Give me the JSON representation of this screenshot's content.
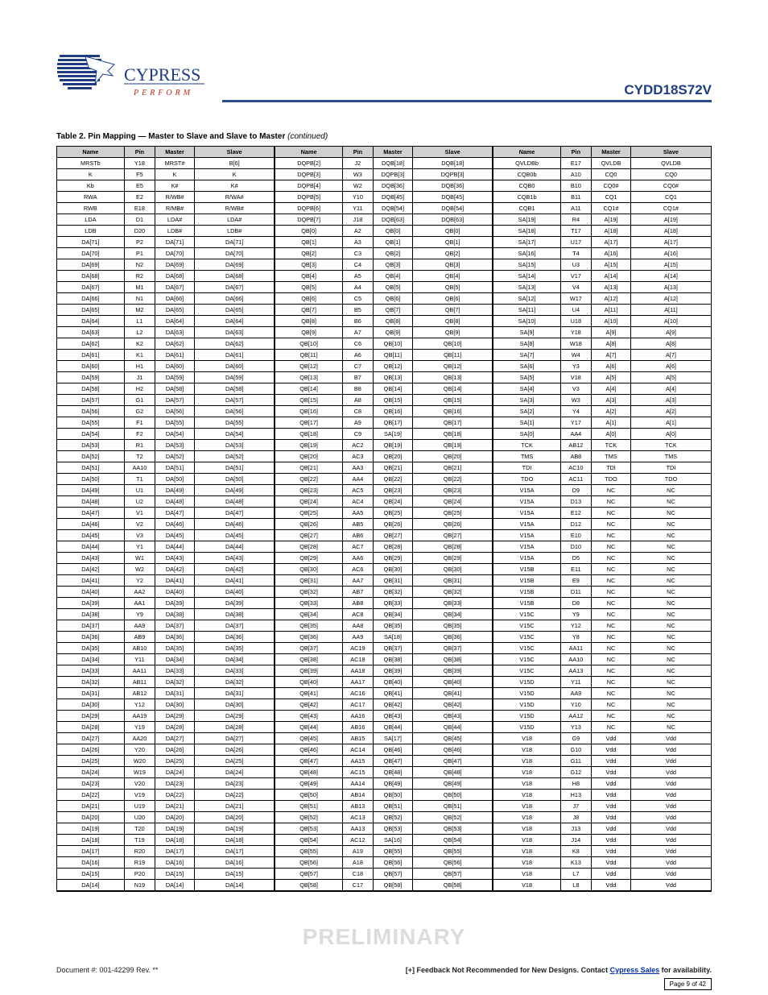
{
  "header": {
    "part": "CYDD18S72V"
  },
  "footer": {
    "watermark": "PRELIMINARY",
    "docnum": "Document #: 001-42299 Rev. **",
    "avail_pre": "[+] Feedback  Not Recommended for New Designs.\nContact ",
    "avail_link": "Cypress Sales",
    "avail_post": " for availability.",
    "page_label": "Page 9 of 42"
  },
  "table": {
    "caption_prefix": "Table 2. ",
    "caption_title": "Pin Mapping — Master to Slave and Slave to Master ",
    "caption_suffix": "(continued)",
    "headers": [
      "Name",
      "Pin",
      "Master",
      "Slave",
      "Name",
      "Pin",
      "Master",
      "Slave",
      "Name",
      "Pin",
      "Master",
      "Slave"
    ],
    "rows": [
      [
        "MRSTb",
        "Y18",
        "MRST#",
        "B[6]",
        "DQPB[2]",
        "J2",
        "DQB[18]",
        "DQB[18]",
        "QVLDBb",
        "E17",
        "QVLDB",
        "QVLDB"
      ],
      [
        "K",
        "F5",
        "K",
        "K",
        "DQPB[3]",
        "W3",
        "DQPB[3]",
        "DQPB[3]",
        "CQB0b",
        "A10",
        "CQ0",
        "CQ0"
      ],
      [
        "Kb",
        "E5",
        "K#",
        "K#",
        "DQPB[4]",
        "W2",
        "DQB[36]",
        "DQB[36]",
        "CQB0",
        "B10",
        "CQ0#",
        "CQ0#"
      ],
      [
        "RWA",
        "E2",
        "R/WB#",
        "R/WA#",
        "DQPB[5]",
        "Y10",
        "DQB[45]",
        "DQB[45]",
        "CQB1b",
        "B11",
        "CQ1",
        "CQ1"
      ],
      [
        "RWB",
        "E18",
        "R/MB#",
        "R/WB#",
        "DQPB[6]",
        "Y11",
        "DQB[54]",
        "DQB[54]",
        "CQB1",
        "A11",
        "CQ1#",
        "CQ1#"
      ],
      [
        "LDA",
        "D1",
        "LDA#",
        "LDA#",
        "DQPB[7]",
        "J18",
        "DQB[63]",
        "DQB[63]",
        "SA[19]",
        "R4",
        "A[19]",
        "A[19]"
      ],
      [
        "LDB",
        "D20",
        "LDB#",
        "LDB#",
        "QB[0]",
        "A2",
        "QB[0]",
        "QB[0]",
        "SA[18]",
        "T17",
        "A[18]",
        "A[18]"
      ],
      [
        "DA[71]",
        "P2",
        "DA[71]",
        "DA[71]",
        "QB[1]",
        "A3",
        "QB[1]",
        "QB[1]",
        "SA[17]",
        "U17",
        "A[17]",
        "A[17]"
      ],
      [
        "DA[70]",
        "P1",
        "DA[70]",
        "DA[70]",
        "QB[2]",
        "C3",
        "QB[2]",
        "QB[2]",
        "SA[16]",
        "T4",
        "A[16]",
        "A[16]"
      ],
      [
        "DA[69]",
        "N2",
        "DA[69]",
        "DA[69]",
        "QB[3]",
        "C4",
        "QB[3]",
        "QB[3]",
        "SA[15]",
        "U3",
        "A[15]",
        "A[15]"
      ],
      [
        "DA[68]",
        "R2",
        "DA[68]",
        "DA[68]",
        "QB[4]",
        "A5",
        "QB[4]",
        "QB[4]",
        "SA[14]",
        "V17",
        "A[14]",
        "A[14]"
      ],
      [
        "DA[67]",
        "M1",
        "DA[67]",
        "DA[67]",
        "QB[5]",
        "A4",
        "QB[5]",
        "QB[5]",
        "SA[13]",
        "V4",
        "A[13]",
        "A[13]"
      ],
      [
        "DA[66]",
        "N1",
        "DA[66]",
        "DA[66]",
        "QB[6]",
        "C5",
        "QB[6]",
        "QB[6]",
        "SA[12]",
        "W17",
        "A[12]",
        "A[12]"
      ],
      [
        "DA[65]",
        "M2",
        "DA[65]",
        "DA[65]",
        "QB[7]",
        "B5",
        "QB[7]",
        "QB[7]",
        "SA[11]",
        "U4",
        "A[11]",
        "A[11]"
      ],
      [
        "DA[64]",
        "L1",
        "DA[64]",
        "DA[64]",
        "QB[8]",
        "B6",
        "QB[8]",
        "QB[8]",
        "SA[10]",
        "U18",
        "A[10]",
        "A[10]"
      ],
      [
        "DA[63]",
        "L2",
        "DA[63]",
        "DA[63]",
        "QB[9]",
        "A7",
        "QB[9]",
        "QB[9]",
        "SA[9]",
        "Y18",
        "A[9]",
        "A[9]"
      ],
      [
        "DA[62]",
        "K2",
        "DA[62]",
        "DA[62]",
        "QB[10]",
        "C6",
        "QB[10]",
        "QB[10]",
        "SA[8]",
        "W18",
        "A[8]",
        "A[8]"
      ],
      [
        "DA[61]",
        "K1",
        "DA[61]",
        "DA[61]",
        "QB[11]",
        "A6",
        "QB[11]",
        "QB[11]",
        "SA[7]",
        "W4",
        "A[7]",
        "A[7]"
      ],
      [
        "DA[60]",
        "H1",
        "DA[60]",
        "DA[60]",
        "QB[12]",
        "C7",
        "QB[12]",
        "QB[12]",
        "SA[6]",
        "Y3",
        "A[6]",
        "A[6]"
      ],
      [
        "DA[59]",
        "J1",
        "DA[59]",
        "DA[59]",
        "QB[13]",
        "B7",
        "QB[13]",
        "QB[13]",
        "SA[5]",
        "V18",
        "A[5]",
        "A[5]"
      ],
      [
        "DA[58]",
        "H2",
        "DA[58]",
        "DA[58]",
        "QB[14]",
        "B8",
        "QB[14]",
        "QB[14]",
        "SA[4]",
        "V3",
        "A[4]",
        "A[4]"
      ],
      [
        "DA[57]",
        "G1",
        "DA[57]",
        "DA[57]",
        "QB[15]",
        "A8",
        "QB[15]",
        "QB[15]",
        "SA[3]",
        "W3",
        "A[3]",
        "A[3]"
      ],
      [
        "DA[56]",
        "G2",
        "DA[56]",
        "DA[56]",
        "QB[16]",
        "C8",
        "QB[16]",
        "QB[16]",
        "SA[2]",
        "Y4",
        "A[2]",
        "A[2]"
      ],
      [
        "DA[55]",
        "F1",
        "DA[55]",
        "DA[55]",
        "QB[17]",
        "A9",
        "QB[17]",
        "QB[17]",
        "SA[1]",
        "Y17",
        "A[1]",
        "A[1]"
      ],
      [
        "DA[54]",
        "F2",
        "DA[54]",
        "DA[54]",
        "QB[18]",
        "C9",
        "SA[19]",
        "QB[18]",
        "SA[0]",
        "AA4",
        "A[0]",
        "A[0]"
      ],
      [
        "DA[53]",
        "R1",
        "DA[53]",
        "DA[53]",
        "QB[19]",
        "AC2",
        "QB[19]",
        "QB[19]",
        "TCK",
        "AB12",
        "TCK",
        "TCK"
      ],
      [
        "DA[52]",
        "T2",
        "DA[52]",
        "DA[52]",
        "QB[20]",
        "AC3",
        "QB[20]",
        "QB[20]",
        "TMS",
        "AB8",
        "TMS",
        "TMS"
      ],
      [
        "DA[51]",
        "AA10",
        "DA[51]",
        "DA[51]",
        "QB[21]",
        "AA3",
        "QB[21]",
        "QB[21]",
        "TDI",
        "AC10",
        "TDI",
        "TDI"
      ],
      [
        "DA[50]",
        "T1",
        "DA[50]",
        "DA[50]",
        "QB[22]",
        "AA4",
        "QB[22]",
        "QB[22]",
        "TDO",
        "AC11",
        "TDO",
        "TDO"
      ],
      [
        "DA[49]",
        "U1",
        "DA[49]",
        "DA[49]",
        "QB[23]",
        "AC5",
        "QB[23]",
        "QB[23]",
        "V15A",
        "D9",
        "NC",
        "NC"
      ],
      [
        "DA[48]",
        "U2",
        "DA[48]",
        "DA[48]",
        "QB[24]",
        "AC4",
        "QB[24]",
        "QB[24]",
        "V15A",
        "D13",
        "NC",
        "NC"
      ],
      [
        "DA[47]",
        "V1",
        "DA[47]",
        "DA[47]",
        "QB[25]",
        "AA5",
        "QB[25]",
        "QB[25]",
        "V15A",
        "E12",
        "NC",
        "NC"
      ],
      [
        "DA[46]",
        "V2",
        "DA[46]",
        "DA[46]",
        "QB[26]",
        "AB5",
        "QB[26]",
        "QB[26]",
        "V15A",
        "D12",
        "NC",
        "NC"
      ],
      [
        "DA[45]",
        "V3",
        "DA[45]",
        "DA[45]",
        "QB[27]",
        "AB6",
        "QB[27]",
        "QB[27]",
        "V15A",
        "E10",
        "NC",
        "NC"
      ],
      [
        "DA[44]",
        "Y1",
        "DA[44]",
        "DA[44]",
        "QB[28]",
        "AC7",
        "QB[28]",
        "QB[28]",
        "V15A",
        "D10",
        "NC",
        "NC"
      ],
      [
        "DA[43]",
        "W1",
        "DA[43]",
        "DA[43]",
        "QB[29]",
        "AA6",
        "QB[29]",
        "QB[29]",
        "V15A",
        "D5",
        "NC",
        "NC"
      ],
      [
        "DA[42]",
        "W2",
        "DA[42]",
        "DA[42]",
        "QB[30]",
        "AC6",
        "QB[30]",
        "QB[30]",
        "V15B",
        "E11",
        "NC",
        "NC"
      ],
      [
        "DA[41]",
        "Y2",
        "DA[41]",
        "DA[41]",
        "QB[31]",
        "AA7",
        "QB[31]",
        "QB[31]",
        "V15B",
        "E9",
        "NC",
        "NC"
      ],
      [
        "DA[40]",
        "AA2",
        "DA[40]",
        "DA[40]",
        "QB[32]",
        "AB7",
        "QB[32]",
        "QB[32]",
        "V15B",
        "D11",
        "NC",
        "NC"
      ],
      [
        "DA[39]",
        "AA1",
        "DA[39]",
        "DA[39]",
        "QB[33]",
        "AB8",
        "QB[33]",
        "QB[33]",
        "V15B",
        "D8",
        "NC",
        "NC"
      ],
      [
        "DA[38]",
        "Y9",
        "DA[38]",
        "DA[38]",
        "QB[34]",
        "AC8",
        "QB[34]",
        "QB[34]",
        "V15C",
        "Y9",
        "NC",
        "NC"
      ],
      [
        "DA[37]",
        "AA9",
        "DA[37]",
        "DA[37]",
        "QB[35]",
        "AA8",
        "QB[35]",
        "QB[35]",
        "V15C",
        "Y12",
        "NC",
        "NC"
      ],
      [
        "DA[36]",
        "AB9",
        "DA[36]",
        "DA[36]",
        "QB[36]",
        "AA9",
        "SA[18]",
        "QB[36]",
        "V15C",
        "Y8",
        "NC",
        "NC"
      ],
      [
        "DA[35]",
        "AB10",
        "DA[35]",
        "DA[35]",
        "QB[37]",
        "AC19",
        "QB[37]",
        "QB[37]",
        "V15C",
        "AA11",
        "NC",
        "NC"
      ],
      [
        "DA[34]",
        "Y11",
        "DA[34]",
        "DA[34]",
        "QB[38]",
        "AC18",
        "QB[38]",
        "QB[38]",
        "V15C",
        "AA10",
        "NC",
        "NC"
      ],
      [
        "DA[33]",
        "AA11",
        "DA[33]",
        "DA[33]",
        "QB[39]",
        "AA18",
        "QB[39]",
        "QB[39]",
        "V15C",
        "AA13",
        "NC",
        "NC"
      ],
      [
        "DA[32]",
        "AB11",
        "DA[32]",
        "DA[32]",
        "QB[40]",
        "AA17",
        "QB[40]",
        "QB[40]",
        "V15D",
        "Y11",
        "NC",
        "NC"
      ],
      [
        "DA[31]",
        "AB12",
        "DA[31]",
        "DA[31]",
        "QB[41]",
        "AC16",
        "QB[41]",
        "QB[41]",
        "V15D",
        "AA9",
        "NC",
        "NC"
      ],
      [
        "DA[30]",
        "Y12",
        "DA[30]",
        "DA[30]",
        "QB[42]",
        "AC17",
        "QB[42]",
        "QB[42]",
        "V15D",
        "Y10",
        "NC",
        "NC"
      ],
      [
        "DA[29]",
        "AA19",
        "DA[29]",
        "DA[29]",
        "QB[43]",
        "AA16",
        "QB[43]",
        "QB[43]",
        "V15D",
        "AA12",
        "NC",
        "NC"
      ],
      [
        "DA[28]",
        "Y19",
        "DA[28]",
        "DA[28]",
        "QB[44]",
        "AB16",
        "QB[44]",
        "QB[44]",
        "V15D",
        "Y13",
        "NC",
        "NC"
      ],
      [
        "DA[27]",
        "AA20",
        "DA[27]",
        "DA[27]",
        "QB[45]",
        "AB15",
        "SA[17]",
        "QB[45]",
        "V18",
        "G9",
        "Vdd",
        "Vdd"
      ],
      [
        "DA[26]",
        "Y20",
        "DA[26]",
        "DA[26]",
        "QB[46]",
        "AC14",
        "QB[46]",
        "QB[46]",
        "V18",
        "G10",
        "Vdd",
        "Vdd"
      ],
      [
        "DA[25]",
        "W20",
        "DA[25]",
        "DA[25]",
        "QB[47]",
        "AA15",
        "QB[47]",
        "QB[47]",
        "V18",
        "G11",
        "Vdd",
        "Vdd"
      ],
      [
        "DA[24]",
        "W19",
        "DA[24]",
        "DA[24]",
        "QB[48]",
        "AC15",
        "QB[48]",
        "QB[48]",
        "V18",
        "G12",
        "Vdd",
        "Vdd"
      ],
      [
        "DA[23]",
        "V20",
        "DA[23]",
        "DA[23]",
        "QB[49]",
        "AA14",
        "QB[49]",
        "QB[49]",
        "V18",
        "H8",
        "Vdd",
        "Vdd"
      ],
      [
        "DA[22]",
        "V19",
        "DA[22]",
        "DA[22]",
        "QB[50]",
        "AB14",
        "QB[50]",
        "QB[50]",
        "V18",
        "H13",
        "Vdd",
        "Vdd"
      ],
      [
        "DA[21]",
        "U19",
        "DA[21]",
        "DA[21]",
        "QB[51]",
        "AB13",
        "QB[51]",
        "QB[51]",
        "V18",
        "J7",
        "Vdd",
        "Vdd"
      ],
      [
        "DA[20]",
        "U20",
        "DA[20]",
        "DA[20]",
        "QB[52]",
        "AC13",
        "QB[52]",
        "QB[52]",
        "V18",
        "J8",
        "Vdd",
        "Vdd"
      ],
      [
        "DA[19]",
        "T20",
        "DA[19]",
        "DA[19]",
        "QB[53]",
        "AA13",
        "QB[53]",
        "QB[53]",
        "V18",
        "J13",
        "Vdd",
        "Vdd"
      ],
      [
        "DA[18]",
        "T19",
        "DA[18]",
        "DA[18]",
        "QB[54]",
        "AC12",
        "SA[16]",
        "QB[54]",
        "V18",
        "J14",
        "Vdd",
        "Vdd"
      ],
      [
        "DA[17]",
        "R20",
        "DA[17]",
        "DA[17]",
        "QB[55]",
        "A19",
        "QB[55]",
        "QB[55]",
        "V18",
        "K8",
        "Vdd",
        "Vdd"
      ],
      [
        "DA[16]",
        "R19",
        "DA[16]",
        "DA[16]",
        "QB[56]",
        "A18",
        "QB[56]",
        "QB[56]",
        "V18",
        "K13",
        "Vdd",
        "Vdd"
      ],
      [
        "DA[15]",
        "P20",
        "DA[15]",
        "DA[15]",
        "QB[57]",
        "C18",
        "QB[57]",
        "QB[57]",
        "V18",
        "L7",
        "Vdd",
        "Vdd"
      ],
      [
        "DA[14]",
        "N19",
        "DA[14]",
        "DA[14]",
        "QB[58]",
        "C17",
        "QB[58]",
        "QB[58]",
        "V18",
        "L8",
        "Vdd",
        "Vdd"
      ]
    ]
  }
}
